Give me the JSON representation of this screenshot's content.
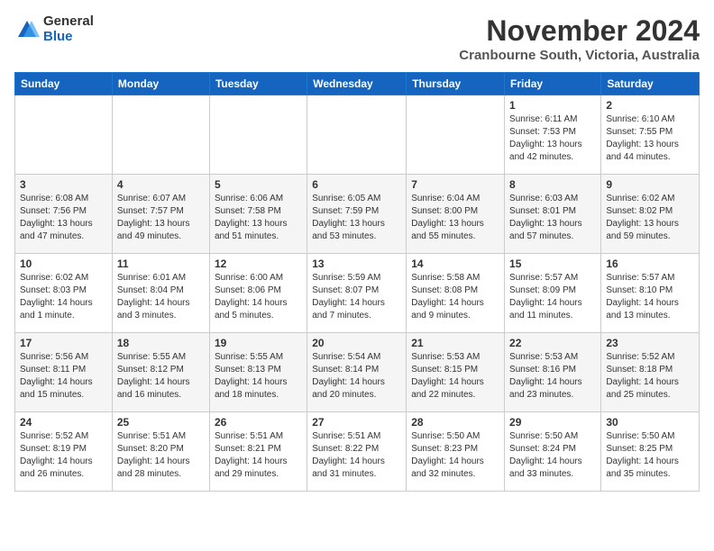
{
  "logo": {
    "general": "General",
    "blue": "Blue"
  },
  "header": {
    "month": "November 2024",
    "location": "Cranbourne South, Victoria, Australia"
  },
  "weekdays": [
    "Sunday",
    "Monday",
    "Tuesday",
    "Wednesday",
    "Thursday",
    "Friday",
    "Saturday"
  ],
  "weeks": [
    [
      {
        "day": "",
        "info": ""
      },
      {
        "day": "",
        "info": ""
      },
      {
        "day": "",
        "info": ""
      },
      {
        "day": "",
        "info": ""
      },
      {
        "day": "",
        "info": ""
      },
      {
        "day": "1",
        "info": "Sunrise: 6:11 AM\nSunset: 7:53 PM\nDaylight: 13 hours\nand 42 minutes."
      },
      {
        "day": "2",
        "info": "Sunrise: 6:10 AM\nSunset: 7:55 PM\nDaylight: 13 hours\nand 44 minutes."
      }
    ],
    [
      {
        "day": "3",
        "info": "Sunrise: 6:08 AM\nSunset: 7:56 PM\nDaylight: 13 hours\nand 47 minutes."
      },
      {
        "day": "4",
        "info": "Sunrise: 6:07 AM\nSunset: 7:57 PM\nDaylight: 13 hours\nand 49 minutes."
      },
      {
        "day": "5",
        "info": "Sunrise: 6:06 AM\nSunset: 7:58 PM\nDaylight: 13 hours\nand 51 minutes."
      },
      {
        "day": "6",
        "info": "Sunrise: 6:05 AM\nSunset: 7:59 PM\nDaylight: 13 hours\nand 53 minutes."
      },
      {
        "day": "7",
        "info": "Sunrise: 6:04 AM\nSunset: 8:00 PM\nDaylight: 13 hours\nand 55 minutes."
      },
      {
        "day": "8",
        "info": "Sunrise: 6:03 AM\nSunset: 8:01 PM\nDaylight: 13 hours\nand 57 minutes."
      },
      {
        "day": "9",
        "info": "Sunrise: 6:02 AM\nSunset: 8:02 PM\nDaylight: 13 hours\nand 59 minutes."
      }
    ],
    [
      {
        "day": "10",
        "info": "Sunrise: 6:02 AM\nSunset: 8:03 PM\nDaylight: 14 hours\nand 1 minute."
      },
      {
        "day": "11",
        "info": "Sunrise: 6:01 AM\nSunset: 8:04 PM\nDaylight: 14 hours\nand 3 minutes."
      },
      {
        "day": "12",
        "info": "Sunrise: 6:00 AM\nSunset: 8:06 PM\nDaylight: 14 hours\nand 5 minutes."
      },
      {
        "day": "13",
        "info": "Sunrise: 5:59 AM\nSunset: 8:07 PM\nDaylight: 14 hours\nand 7 minutes."
      },
      {
        "day": "14",
        "info": "Sunrise: 5:58 AM\nSunset: 8:08 PM\nDaylight: 14 hours\nand 9 minutes."
      },
      {
        "day": "15",
        "info": "Sunrise: 5:57 AM\nSunset: 8:09 PM\nDaylight: 14 hours\nand 11 minutes."
      },
      {
        "day": "16",
        "info": "Sunrise: 5:57 AM\nSunset: 8:10 PM\nDaylight: 14 hours\nand 13 minutes."
      }
    ],
    [
      {
        "day": "17",
        "info": "Sunrise: 5:56 AM\nSunset: 8:11 PM\nDaylight: 14 hours\nand 15 minutes."
      },
      {
        "day": "18",
        "info": "Sunrise: 5:55 AM\nSunset: 8:12 PM\nDaylight: 14 hours\nand 16 minutes."
      },
      {
        "day": "19",
        "info": "Sunrise: 5:55 AM\nSunset: 8:13 PM\nDaylight: 14 hours\nand 18 minutes."
      },
      {
        "day": "20",
        "info": "Sunrise: 5:54 AM\nSunset: 8:14 PM\nDaylight: 14 hours\nand 20 minutes."
      },
      {
        "day": "21",
        "info": "Sunrise: 5:53 AM\nSunset: 8:15 PM\nDaylight: 14 hours\nand 22 minutes."
      },
      {
        "day": "22",
        "info": "Sunrise: 5:53 AM\nSunset: 8:16 PM\nDaylight: 14 hours\nand 23 minutes."
      },
      {
        "day": "23",
        "info": "Sunrise: 5:52 AM\nSunset: 8:18 PM\nDaylight: 14 hours\nand 25 minutes."
      }
    ],
    [
      {
        "day": "24",
        "info": "Sunrise: 5:52 AM\nSunset: 8:19 PM\nDaylight: 14 hours\nand 26 minutes."
      },
      {
        "day": "25",
        "info": "Sunrise: 5:51 AM\nSunset: 8:20 PM\nDaylight: 14 hours\nand 28 minutes."
      },
      {
        "day": "26",
        "info": "Sunrise: 5:51 AM\nSunset: 8:21 PM\nDaylight: 14 hours\nand 29 minutes."
      },
      {
        "day": "27",
        "info": "Sunrise: 5:51 AM\nSunset: 8:22 PM\nDaylight: 14 hours\nand 31 minutes."
      },
      {
        "day": "28",
        "info": "Sunrise: 5:50 AM\nSunset: 8:23 PM\nDaylight: 14 hours\nand 32 minutes."
      },
      {
        "day": "29",
        "info": "Sunrise: 5:50 AM\nSunset: 8:24 PM\nDaylight: 14 hours\nand 33 minutes."
      },
      {
        "day": "30",
        "info": "Sunrise: 5:50 AM\nSunset: 8:25 PM\nDaylight: 14 hours\nand 35 minutes."
      }
    ]
  ]
}
